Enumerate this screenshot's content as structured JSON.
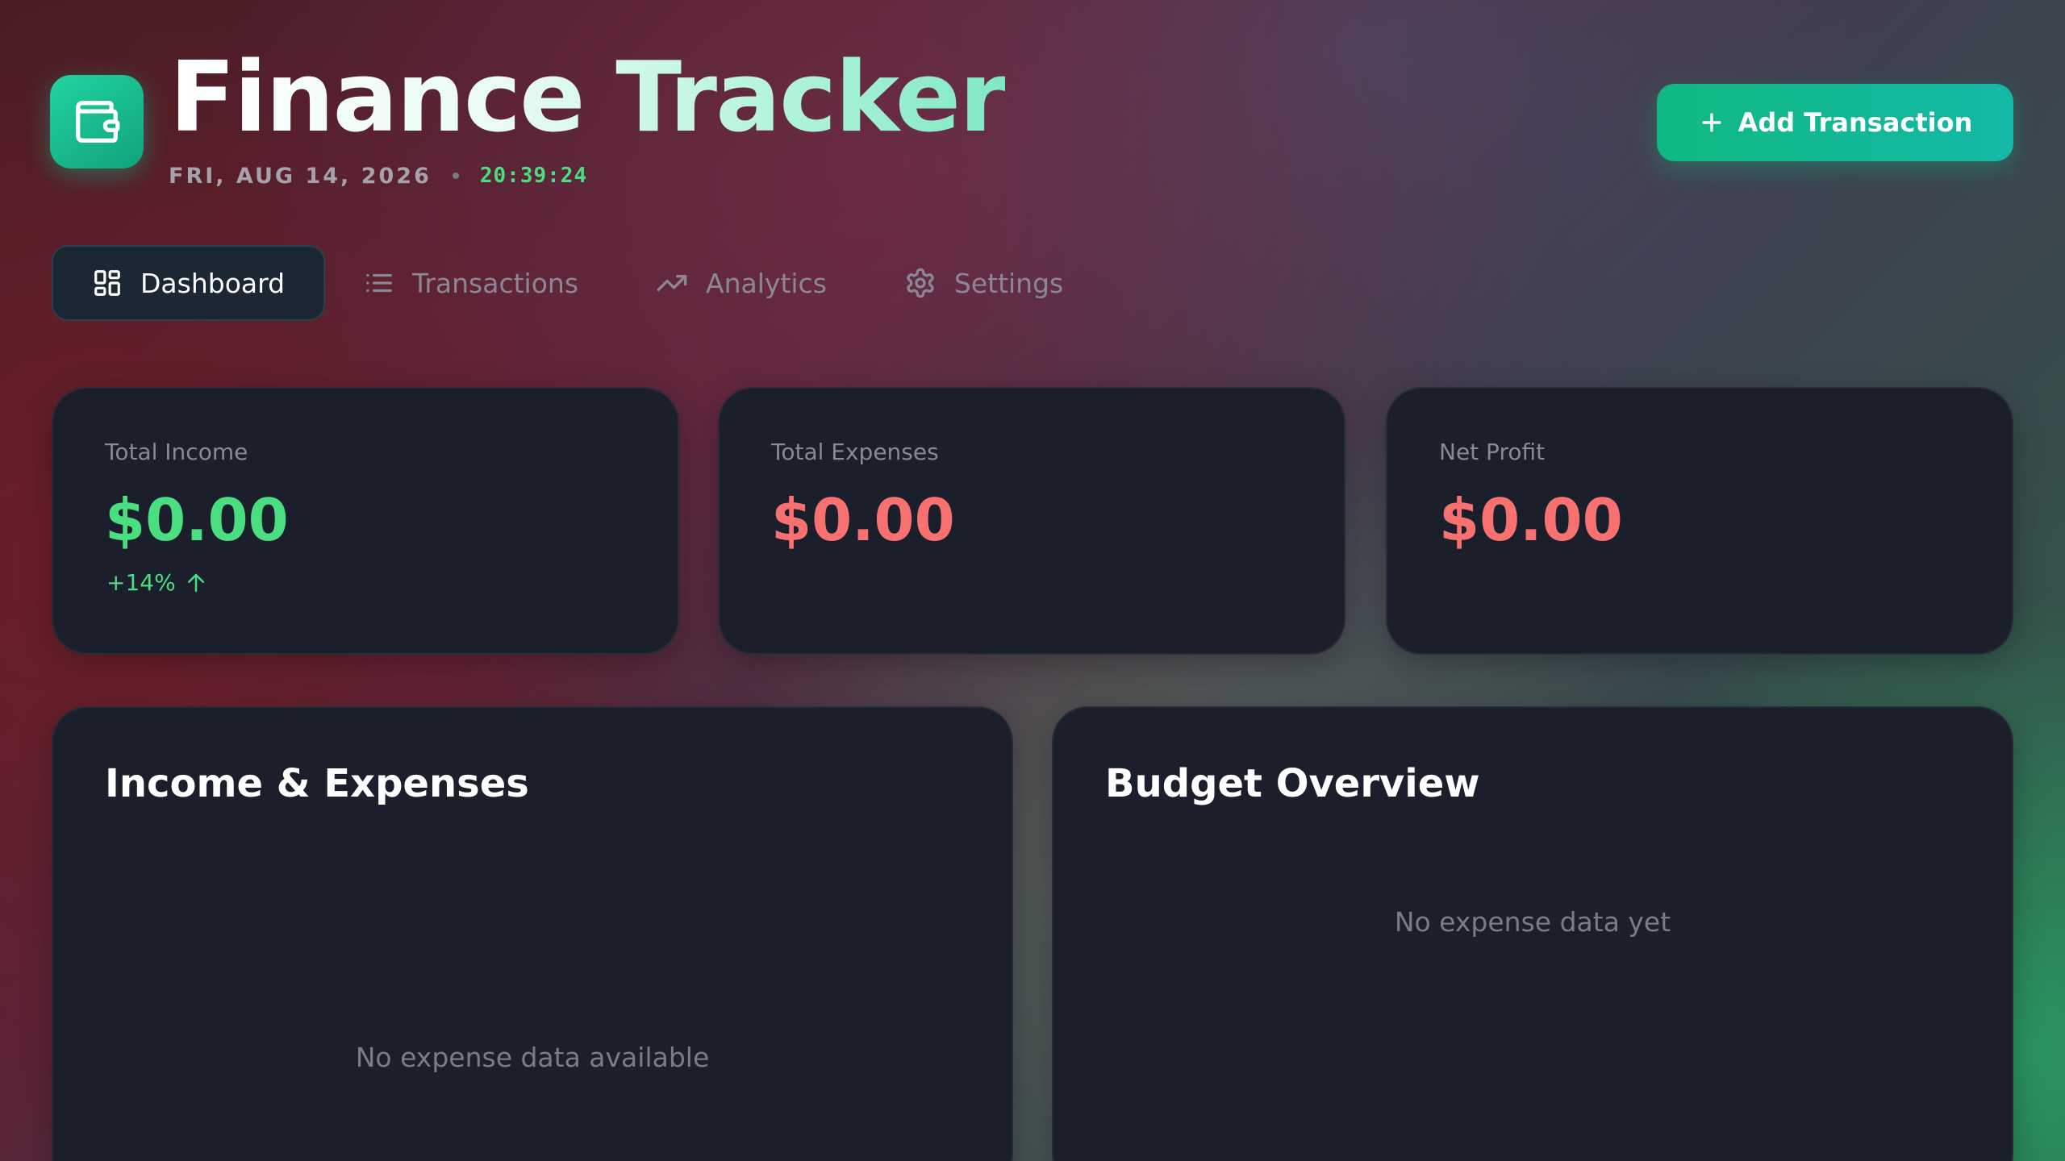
{
  "header": {
    "title": "Finance Tracker",
    "date": "FRI, AUG 14, 2026",
    "time": "20:39:24",
    "add_button_label": "Add Transaction",
    "logo_icon": "wallet-icon"
  },
  "nav": {
    "tabs": [
      {
        "label": "Dashboard",
        "icon": "dashboard-icon",
        "active": true
      },
      {
        "label": "Transactions",
        "icon": "list-icon",
        "active": false
      },
      {
        "label": "Analytics",
        "icon": "trending-up-icon",
        "active": false
      },
      {
        "label": "Settings",
        "icon": "gear-icon",
        "active": false
      }
    ]
  },
  "stats": [
    {
      "label": "Total Income",
      "value": "$0.00",
      "delta": "+14%",
      "color": "#4ade80"
    },
    {
      "label": "Total Expenses",
      "value": "$0.00",
      "color": "#f87171"
    },
    {
      "label": "Net Profit",
      "value": "$0.00",
      "color": "#f87171"
    }
  ],
  "panels": {
    "income_expenses": {
      "title": "Income & Expenses",
      "empty_text": "No expense data available"
    },
    "budget_overview": {
      "title": "Budget Overview",
      "empty_text": "No expense data yet"
    }
  },
  "colors": {
    "accent": "#10b981",
    "positive": "#4ade80",
    "negative": "#f87171",
    "card_bg": "#1b1f2c"
  }
}
